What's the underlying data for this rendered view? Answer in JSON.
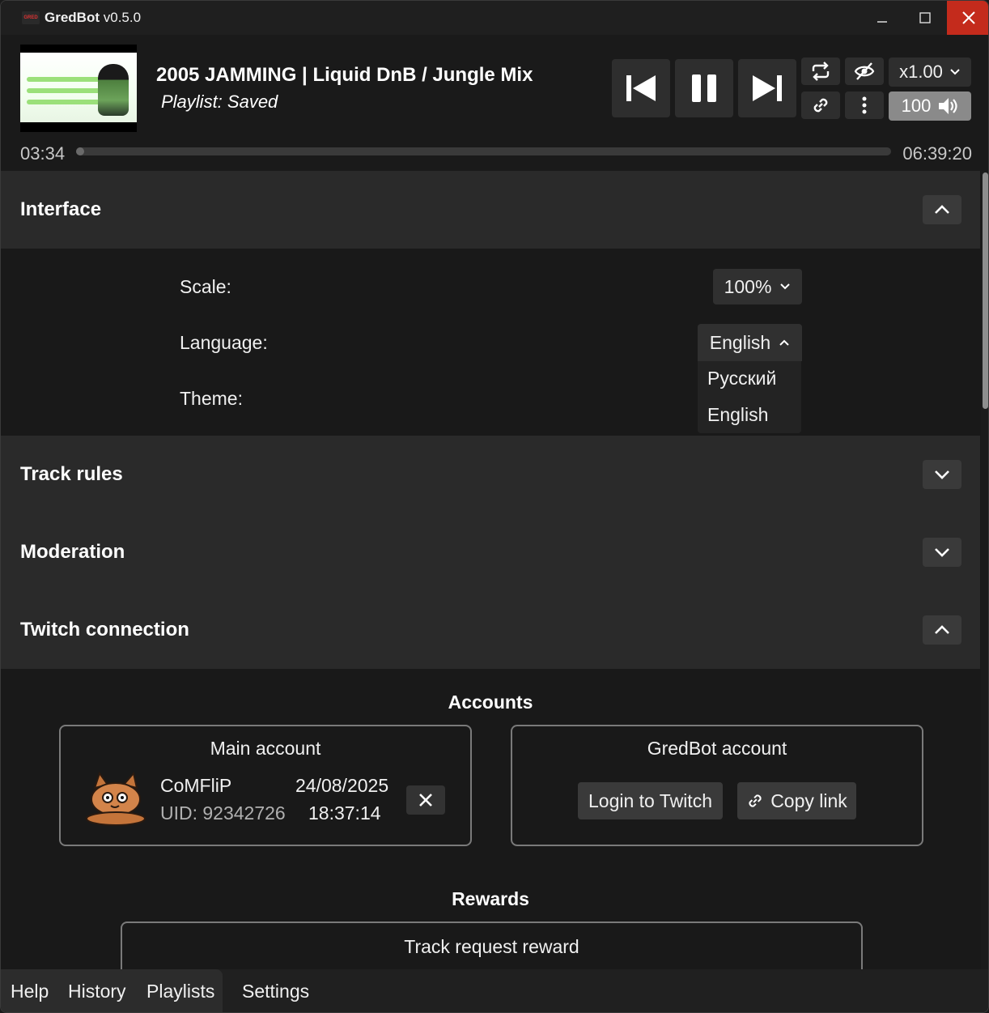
{
  "window": {
    "logo_text": "GRED",
    "app_name": "GredBot",
    "version": "v0.5.0",
    "controls": [
      "minimize-icon",
      "maximize-icon",
      "close-icon"
    ]
  },
  "player": {
    "track_title": "2005 JAMMING | Liquid DnB / Jungle Mix",
    "playlist": "Playlist: Saved",
    "speed": "x1.00",
    "volume": "100",
    "time_current": "03:34",
    "time_total": "06:39:20",
    "progress_fraction": 0.009,
    "icons": [
      "previous-icon",
      "pause-icon",
      "next-icon",
      "repeat-icon",
      "hidden-eye-icon",
      "link-icon",
      "more-vertical-icon",
      "speaker-icon"
    ]
  },
  "interface": {
    "title": "Interface",
    "scale_label": "Scale:",
    "scale_value": "100%",
    "language_label": "Language:",
    "language_value": "English",
    "language_options": [
      "Русский",
      "English"
    ],
    "theme_label": "Theme:"
  },
  "sections": {
    "track_rules": "Track rules",
    "moderation": "Moderation",
    "twitch_connection": "Twitch connection"
  },
  "twitch": {
    "accounts_heading": "Accounts",
    "main_account": {
      "title": "Main account",
      "username": "CoMFliP",
      "uid": "UID: 92342726",
      "date": "24/08/2025",
      "time": "18:37:14"
    },
    "bot_account": {
      "title": "GredBot account",
      "login_label": "Login to Twitch",
      "copy_label": "Copy link"
    },
    "rewards_heading": "Rewards",
    "reward_title": "Track request reward"
  },
  "nav": {
    "tabs": [
      "Help",
      "History",
      "Playlists",
      "Settings"
    ],
    "active": "Settings"
  },
  "colors": {
    "close_button": "#c42b1c",
    "section_header": "#2a2a2a",
    "background": "#191919"
  }
}
